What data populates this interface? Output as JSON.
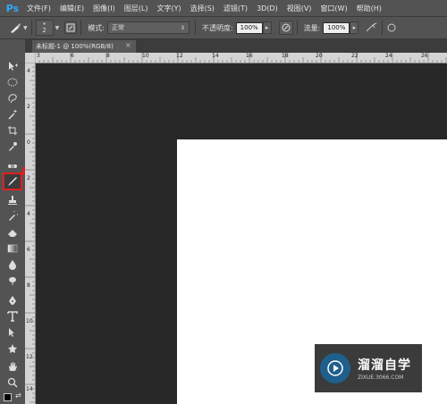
{
  "app": {
    "logo": "Ps"
  },
  "menu": [
    "文件(F)",
    "编辑(E)",
    "图像(I)",
    "图层(L)",
    "文字(Y)",
    "选择(S)",
    "滤镜(T)",
    "3D(D)",
    "视图(V)",
    "窗口(W)",
    "帮助(H)"
  ],
  "options": {
    "brush_size": "2",
    "mode_label": "模式:",
    "mode_value": "正常",
    "opacity_label": "不透明度:",
    "opacity_value": "100%",
    "flow_label": "流量:",
    "flow_value": "100%"
  },
  "document": {
    "tab_title": "未标题-1 @ 100%(RGB/8)",
    "close": "×"
  },
  "rulers": {
    "top_ticks": [
      "3",
      "6",
      "8",
      "10",
      "12",
      "14",
      "16",
      "18",
      "20",
      "22",
      "24",
      "26",
      "28",
      "30"
    ],
    "left_ticks": [
      "4",
      "2",
      "0",
      "2",
      "4",
      "6",
      "8",
      "10",
      "12",
      "14",
      "16",
      "18"
    ]
  },
  "tools": [
    "move-tool",
    "marquee-tool",
    "lasso-tool",
    "magic-wand-tool",
    "crop-tool",
    "eyedropper-tool",
    "healing-brush-tool",
    "brush-tool",
    "clone-stamp-tool",
    "history-brush-tool",
    "eraser-tool",
    "gradient-tool",
    "blur-tool",
    "dodge-tool",
    "pen-tool",
    "type-tool",
    "path-selection-tool",
    "shape-tool",
    "hand-tool",
    "zoom-tool"
  ],
  "selected_tool": "brush-tool",
  "watermark": {
    "title": "溜溜自学",
    "url": "ZIXUE.3066.COM"
  },
  "colors": {
    "accent_red": "#e02020",
    "ps_blue": "#31a8ff"
  }
}
